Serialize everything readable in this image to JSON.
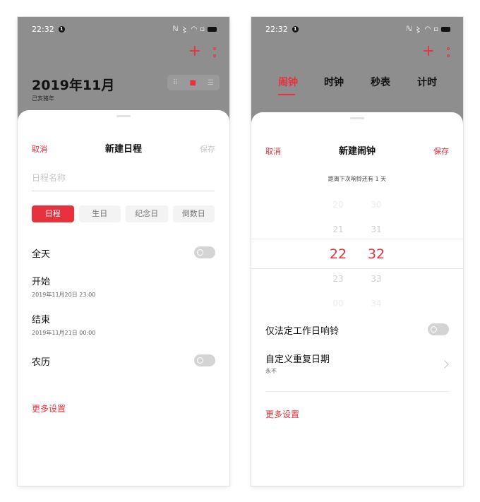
{
  "status_bar": {
    "time": "22:32",
    "notification_badge": "1",
    "system_icons": "nfc, vibrate, wifi, battery"
  },
  "calendar_screen": {
    "month_title": "2019年11月",
    "lunar_year": "己亥猪年",
    "add_icon": "plus-icon",
    "more_icon": "kebab-icon",
    "view_switch": [
      "year-view-icon",
      "month-view-icon",
      "list-view-icon"
    ],
    "active_view": "month-view-icon",
    "sheet": {
      "cancel": "取消",
      "title": "新建日程",
      "save": "保存",
      "name_placeholder": "日程名称",
      "name_value": "",
      "types": [
        "日程",
        "生日",
        "纪念日",
        "倒数日"
      ],
      "active_type": "日程",
      "all_day_label": "全天",
      "all_day_on": false,
      "start_label": "开始",
      "start_value": "2019年11月20日 23:00",
      "end_label": "结束",
      "end_value": "2019年11月21日 00:00",
      "lunar_label": "农历",
      "lunar_on": false,
      "more_settings": "更多设置"
    }
  },
  "clock_screen": {
    "tabs": [
      "闹钟",
      "时钟",
      "秒表",
      "计时"
    ],
    "active_tab": "闹钟",
    "add_icon": "plus-icon",
    "more_icon": "kebab-icon",
    "sheet": {
      "cancel": "取消",
      "title": "新建闹钟",
      "save": "保存",
      "countdown": "距离下次响铃还有 1 天",
      "time_picker": {
        "hours": [
          "20",
          "21",
          "22",
          "23",
          "00"
        ],
        "minutes": [
          "30",
          "31",
          "32",
          "33",
          "34"
        ],
        "selected_hour": "22",
        "selected_minute": "32"
      },
      "workday_label": "仅法定工作日响铃",
      "workday_on": false,
      "repeat_label": "自定义重复日期",
      "repeat_value": "永不",
      "more_settings": "更多设置"
    }
  },
  "colors": {
    "accent": "#e8313c",
    "scrim": "#8e8e8e",
    "muted_text": "#c8c8c8",
    "toggle_off": "#d4d4d4"
  }
}
